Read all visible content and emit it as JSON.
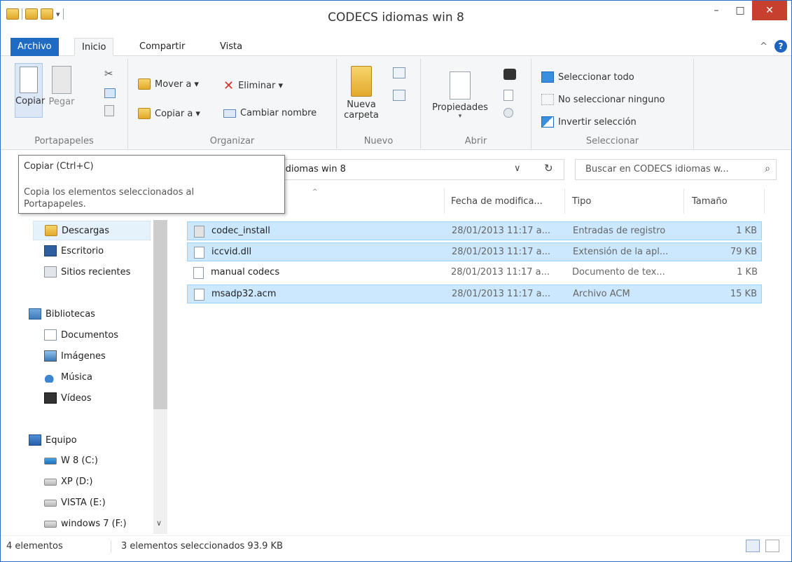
{
  "window": {
    "title": "CODECS idiomas win 8",
    "minimize": "–",
    "maximize": "□",
    "close": "✕"
  },
  "ribbon_tabs": [
    "Archivo",
    "Inicio",
    "Compartir",
    "Vista"
  ],
  "ribbon_right": {
    "collapse": "^",
    "help": "?"
  },
  "ribbon": {
    "portapapeles": {
      "label": "Portapapeles",
      "copy": "Copiar",
      "paste": "Pegar"
    },
    "organizar": {
      "label": "Organizar",
      "move": "Mover a ▾",
      "copy_to": "Copiar a ▾",
      "delete": "Eliminar ▾",
      "rename": "Cambiar nombre"
    },
    "nuevo": {
      "label": "Nuevo",
      "new_folder_1": "Nueva",
      "new_folder_2": "carpeta"
    },
    "abrir": {
      "label": "Abrir",
      "properties": "Propiedades",
      "properties_arrow": "▾"
    },
    "seleccionar": {
      "label": "Seleccionar",
      "select_all": "Seleccionar todo",
      "select_none": "No seleccionar ninguno",
      "invert": "Invertir selección"
    }
  },
  "tooltip": {
    "title": "Copiar (Ctrl+C)",
    "body": "Copia los elementos seleccionados al Portapapeles."
  },
  "address": {
    "text": "idiomas win 8",
    "dropdown": "∨",
    "refresh": "↻"
  },
  "search": {
    "placeholder": "Buscar en CODECS idiomas w...",
    "icon": "⌕"
  },
  "columns": {
    "sort": "^",
    "date": "Fecha de modifica...",
    "type": "Tipo",
    "size": "Tamaño"
  },
  "nav": {
    "downloads": "Descargas",
    "desktop": "Escritorio",
    "recent": "Sitios recientes",
    "libraries": "Bibliotecas",
    "documents": "Documentos",
    "images": "Imágenes",
    "music": "Música",
    "videos": "Vídeos",
    "computer": "Equipo",
    "drive_c": "W 8 (C:)",
    "drive_d": "XP (D:)",
    "drive_e": "VISTA (E:)",
    "drive_f": "windows 7 (F:)",
    "scroll_down": "∨"
  },
  "files": [
    {
      "name": "codec_install",
      "date": "28/01/2013 11:17 a...",
      "type": "Entradas de registro",
      "size": "1 KB",
      "selected": true
    },
    {
      "name": "iccvid.dll",
      "date": "28/01/2013 11:17 a...",
      "type": "Extensión de la apl...",
      "size": "79 KB",
      "selected": true
    },
    {
      "name": "manual codecs",
      "date": "28/01/2013 11:17 a...",
      "type": "Documento de tex...",
      "size": "1 KB",
      "selected": false
    },
    {
      "name": "msadp32.acm",
      "date": "28/01/2013 11:17 a...",
      "type": "Archivo ACM",
      "size": "15 KB",
      "selected": true
    }
  ],
  "status": {
    "count": "4 elementos",
    "selected": "3 elementos seleccionados  93.9 KB"
  },
  "colors": {
    "accent": "#1f6ac2",
    "selection": "#cce8ff",
    "close": "#c7402e"
  }
}
